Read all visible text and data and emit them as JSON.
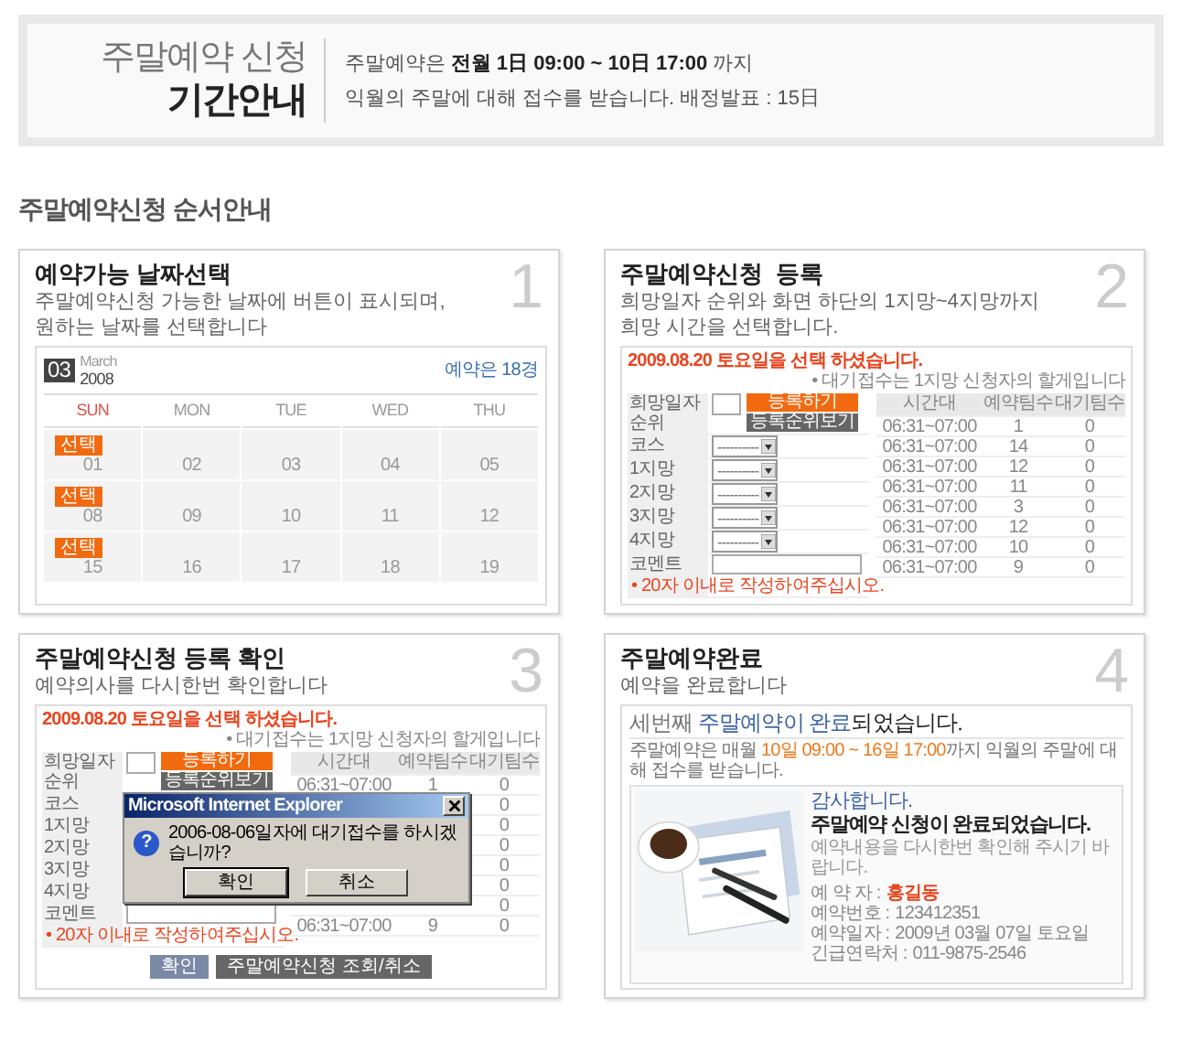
{
  "header": {
    "title_top": "주말예약 신청",
    "title_bottom": "기간안내",
    "info": [
      "주말예약은 **전월 1日 09:00 ~ 10日 17:00** 까지",
      "익월의 주말에 대해 접수를 받습니다. 배정발표 : 15日"
    ]
  },
  "section_title": "주말예약신청 순서안내",
  "steps": [
    {
      "kind": "calendar",
      "title": "예약가능 날짜선택",
      "description": [
        "주말예약신청 가능한 날짜에 버튼이 표시되며,",
        "원하는 날짜를 선택합니다"
      ],
      "number": "1",
      "calendar": {
        "month": "03",
        "month_name": "March",
        "year": "2008",
        "note": "예약은 18경",
        "weekdays": [
          {
            "label": "SUN",
            "sunday": true
          },
          {
            "label": "MON",
            "sunday": false
          },
          {
            "label": "TUE",
            "sunday": false
          },
          {
            "label": "WED",
            "sunday": false
          },
          {
            "label": "THU",
            "sunday": false
          }
        ],
        "weeks": [
          [
            {
              "day": "01",
              "button": "선택"
            },
            {
              "day": "02"
            },
            {
              "day": "03"
            },
            {
              "day": "04"
            },
            {
              "day": "05"
            }
          ],
          [
            {
              "day": "08",
              "button": "선택"
            },
            {
              "day": "09"
            },
            {
              "day": "10"
            },
            {
              "day": "11"
            },
            {
              "day": "12"
            }
          ],
          [
            {
              "day": "15",
              "button": "선택"
            },
            {
              "day": "16"
            },
            {
              "day": "17"
            },
            {
              "day": "18"
            },
            {
              "day": "19"
            }
          ]
        ]
      }
    },
    {
      "kind": "form",
      "title": "주말예약신청  등록",
      "description": [
        "희망일자 순위와 화면 하단의 1지망~4지망까지",
        "희망 시간을 선택합니다."
      ],
      "number": "2",
      "form": {
        "alert": "2009.08.20 토요일을 선택 하셨습니다.",
        "note": "• 대기접수는 1지망 신청자의 할게입니다",
        "rows": [
          {
            "kind": "rank",
            "label": "희망일자 순위",
            "buttons": [
              "등록하기",
              "등록순위보기"
            ]
          },
          {
            "kind": "select",
            "label": "코스",
            "value": "----------"
          },
          {
            "kind": "select",
            "label": "1지망",
            "value": "----------"
          },
          {
            "kind": "select",
            "label": "2지망",
            "value": "----------"
          },
          {
            "kind": "select",
            "label": "3지망",
            "value": "----------"
          },
          {
            "kind": "select",
            "label": "4지망",
            "value": "----------"
          },
          {
            "kind": "comment",
            "label": "코멘트",
            "hint": "• 20자 이내로 작성하여주십시오."
          }
        ],
        "columns": [
          "시간대",
          "예약팀수",
          "대기팀수"
        ],
        "rows_table": [
          {
            "time": "06:31~07:00",
            "reserved": "1",
            "waiting": "0"
          },
          {
            "time": "06:31~07:00",
            "reserved": "14",
            "waiting": "0"
          },
          {
            "time": "06:31~07:00",
            "reserved": "12",
            "waiting": "0"
          },
          {
            "time": "06:31~07:00",
            "reserved": "11",
            "waiting": "0"
          },
          {
            "time": "06:31~07:00",
            "reserved": "3",
            "waiting": "0"
          },
          {
            "time": "06:31~07:00",
            "reserved": "12",
            "waiting": "0"
          },
          {
            "time": "06:31~07:00",
            "reserved": "10",
            "waiting": "0"
          },
          {
            "time": "06:31~07:00",
            "reserved": "9",
            "waiting": "0"
          }
        ]
      }
    },
    {
      "kind": "confirm",
      "title": "주말예약신청 등록 확인",
      "description": [
        "예약의사를 다시한번 확인합니다"
      ],
      "number": "3",
      "form": {
        "alert": "2009.08.20 토요일을 선택 하셨습니다.",
        "note": "• 대기접수는 1지망 신청자의 할게입니다",
        "rows": [
          {
            "kind": "rank",
            "label": "희망일자 순위",
            "buttons": [
              "등록하기",
              "등록순위보기"
            ]
          },
          {
            "kind": "select",
            "label": "코스"
          },
          {
            "kind": "select",
            "label": "1지망"
          },
          {
            "kind": "select",
            "label": "2지망"
          },
          {
            "kind": "select",
            "label": "3지망"
          },
          {
            "kind": "select",
            "label": "4지망"
          },
          {
            "kind": "comment",
            "label": "코멘트",
            "hint": "• 20자 이내로 작성하여주십시오."
          }
        ],
        "columns": [
          "시간대",
          "예약팀수",
          "대기팀수"
        ],
        "rows_table": [
          {
            "time": "06:31~07:00",
            "reserved": "1",
            "waiting": "0"
          },
          {
            "waiting": "0"
          },
          {
            "waiting": "0"
          },
          {
            "waiting": "0"
          },
          {
            "waiting": "0"
          },
          {
            "waiting": "0"
          },
          {
            "waiting": "0"
          },
          {
            "time": "06:31~07:00",
            "reserved": "9",
            "waiting": "0"
          }
        ],
        "actions": [
          "확인",
          "주말예약신청 조회/취소"
        ]
      },
      "dialog": {
        "title": "Microsoft Internet Explorer",
        "icon": "?",
        "message": "2006-08-06일자에 대기접수를 하시겠습니까?",
        "buttons": [
          "확인",
          "취소"
        ]
      }
    },
    {
      "kind": "complete",
      "title": "주말예약완료",
      "description": [
        "예약을 완료합니다"
      ],
      "number": "4",
      "complete": {
        "headline": [
          {
            "text": "세번째 ",
            "kind": "plain"
          },
          {
            "text": "주말예약이 완료",
            "kind": "accent"
          },
          {
            "text": "되었습니다.",
            "kind": "strong"
          }
        ],
        "notice": [
          {
            "text": "주말예약은 매월 ",
            "kind": "plain"
          },
          {
            "text": "10일 09:00 ~ 16일 17:00",
            "kind": "warm"
          },
          {
            "text": "까지 익월의 주말에 대해 접수를 받습니다.",
            "kind": "plain"
          }
        ],
        "thanks": "감사합니다.",
        "message": "주말예약 신청이 완료되었습니다.",
        "sub": "예약내용을 다시한번 확인해 주시기 바랍니다.",
        "details": [
          {
            "label": "예 약 자 :",
            "value": "홍길동",
            "highlight": true
          },
          {
            "label": "예약번호 :",
            "value": "123412351",
            "highlight": false
          },
          {
            "label": "예약일자 :",
            "value": "2009년 03월 07일 토요일",
            "highlight": false
          },
          {
            "label": "긴급연락처 :",
            "value": "011-9875-2546",
            "highlight": false
          }
        ]
      }
    }
  ]
}
